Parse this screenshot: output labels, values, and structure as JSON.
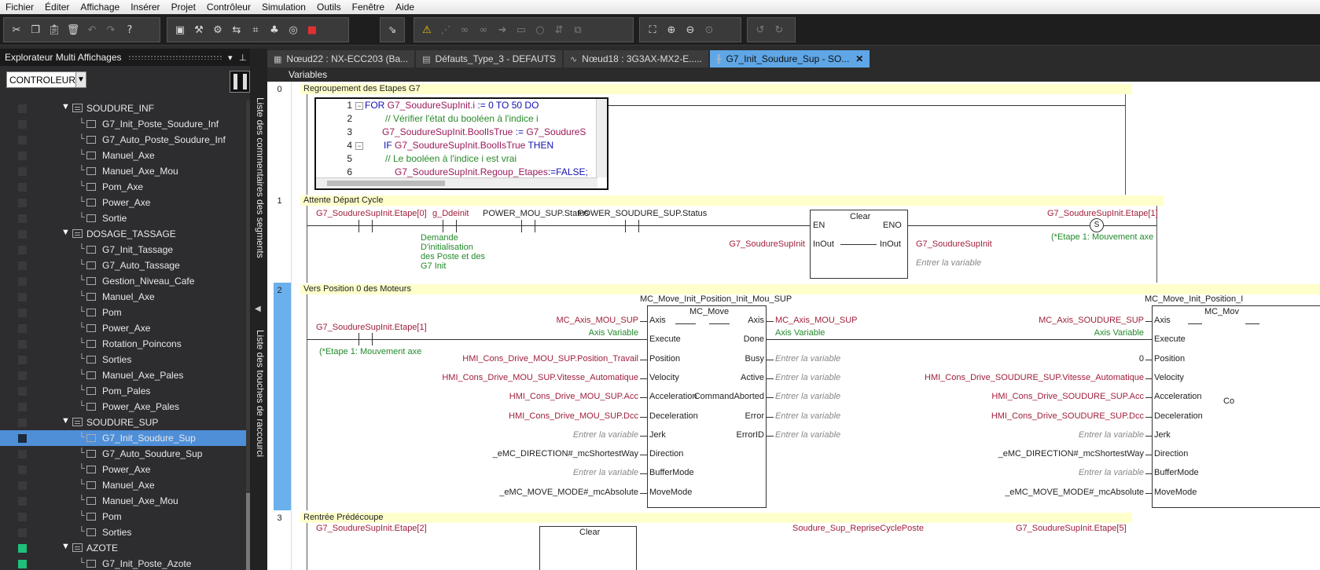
{
  "menu": [
    "Fichier",
    "Éditer",
    "Affichage",
    "Insérer",
    "Projet",
    "Contrôleur",
    "Simulation",
    "Outils",
    "Fenêtre",
    "Aide"
  ],
  "toolbar": {
    "group1": [
      "cut-icon",
      "copy-icon",
      "paste-icon",
      "delete-icon",
      "undo-icon",
      "redo-icon",
      "help-icon"
    ],
    "group2": [
      "build-icon",
      "hammer-icon",
      "tools-icon",
      "compare-icon",
      "cross-reference-icon",
      "binoculars-icon",
      "stop-icon"
    ],
    "group3": [
      "transfer-icon"
    ],
    "group4": [
      "warning-icon",
      "monitor-icon",
      "online-icon",
      "offline-icon",
      "step-icon",
      "pause-icon",
      "reset-icon",
      "sync-icon",
      "link-icon"
    ],
    "group5": [
      "zoom-fit-icon",
      "zoom-in-icon",
      "zoom-out-icon",
      "zoom-custom-icon"
    ],
    "group6": [
      "back-icon",
      "forward-icon"
    ]
  },
  "explorer": {
    "title": "Explorateur Multi Affichages",
    "controller": "CONTROLEUR",
    "rows": [
      {
        "type": "group",
        "label": "SOUDURE_INF",
        "sq": "gray"
      },
      {
        "type": "item",
        "label": "G7_Init_Poste_Soudure_Inf",
        "sq": "gray"
      },
      {
        "type": "item",
        "label": "G7_Auto_Poste_Soudure_Inf",
        "sq": "gray"
      },
      {
        "type": "item",
        "label": "Manuel_Axe",
        "sq": "gray"
      },
      {
        "type": "item",
        "label": "Manuel_Axe_Mou",
        "sq": "gray"
      },
      {
        "type": "item",
        "label": "Pom_Axe",
        "sq": "gray"
      },
      {
        "type": "item",
        "label": "Power_Axe",
        "sq": "gray"
      },
      {
        "type": "item",
        "label": "Sortie",
        "sq": "gray"
      },
      {
        "type": "group",
        "label": "DOSAGE_TASSAGE",
        "sq": "gray"
      },
      {
        "type": "item",
        "label": "G7_Init_Tassage",
        "sq": "gray"
      },
      {
        "type": "item",
        "label": "G7_Auto_Tassage",
        "sq": "gray"
      },
      {
        "type": "item",
        "label": "Gestion_Niveau_Cafe",
        "sq": "gray"
      },
      {
        "type": "item",
        "label": "Manuel_Axe",
        "sq": "gray"
      },
      {
        "type": "item",
        "label": "Pom",
        "sq": "gray"
      },
      {
        "type": "item",
        "label": "Power_Axe",
        "sq": "gray"
      },
      {
        "type": "item",
        "label": "Rotation_Poincons",
        "sq": "gray"
      },
      {
        "type": "item",
        "label": "Sorties",
        "sq": "gray"
      },
      {
        "type": "item",
        "label": "Manuel_Axe_Pales",
        "sq": "gray"
      },
      {
        "type": "item",
        "label": "Pom_Pales",
        "sq": "gray"
      },
      {
        "type": "item",
        "label": "Power_Axe_Pales",
        "sq": "gray"
      },
      {
        "type": "group",
        "label": "SOUDURE_SUP",
        "sq": "gray"
      },
      {
        "type": "item",
        "label": "G7_Init_Soudure_Sup",
        "sq": "dark",
        "selected": true
      },
      {
        "type": "item",
        "label": "G7_Auto_Soudure_Sup",
        "sq": "gray"
      },
      {
        "type": "item",
        "label": "Power_Axe",
        "sq": "gray"
      },
      {
        "type": "item",
        "label": "Manuel_Axe",
        "sq": "gray"
      },
      {
        "type": "item",
        "label": "Manuel_Axe_Mou",
        "sq": "gray"
      },
      {
        "type": "item",
        "label": "Pom",
        "sq": "gray"
      },
      {
        "type": "item",
        "label": "Sorties",
        "sq": "gray"
      },
      {
        "type": "group",
        "label": "AZOTE",
        "sq": "green"
      },
      {
        "type": "item",
        "label": "G7_Init_Poste_Azote",
        "sq": "green"
      }
    ]
  },
  "side_tabs": {
    "comments": "Liste des commentaires des segments",
    "shortcuts": "Liste des touches de raccourci"
  },
  "tabs": [
    {
      "label": "Nœud22 : NX-ECC203 (Ba...",
      "icon": "network-icon"
    },
    {
      "label": "Défauts_Type_3 - DEFAUTS",
      "icon": "table-icon"
    },
    {
      "label": "Nœud18 : 3G3AX-MX2-E.....",
      "icon": "drive-icon"
    },
    {
      "label": "G7_Init_Soudure_Sup - SO...",
      "icon": "ladder-icon",
      "active": true
    }
  ],
  "variables_label": "Variables",
  "rungs": {
    "r0": {
      "number": "0",
      "title": "Regroupement des Etapes G7",
      "st_line_numbers": [
        "1",
        "2",
        "3",
        "4",
        "5",
        "6"
      ],
      "st": {
        "l1a": "FOR ",
        "l1b": "G7_SoudureSupInit.i",
        "l1c": " := ",
        "l1d": "0",
        "l1e": " TO ",
        "l1f": "50",
        "l1g": " DO",
        "l2": "// Vérifier l'état du booléen à l'indice i",
        "l3a": "G7_SoudureSupInit.BoolIsTrue",
        "l3b": " := ",
        "l3c": "G7_SoudureS",
        "l4a": "IF ",
        "l4b": "G7_SoudureSupInit.BoolIsTrue",
        "l4c": " THEN",
        "l5": "// Le booléen à l'indice i est vrai",
        "l6a": "G7_SoudureSupInit.Regoup_Etapes",
        "l6b": ":=",
        "l6c": "FALSE;"
      }
    },
    "r1": {
      "number": "1",
      "title": "Attente Départ Cycle",
      "c1": "G7_SoudureSupInit.Etape[0]",
      "c2": "g_Ddeinit",
      "c2_comment": [
        "Demande",
        "D'initialisation",
        "des Poste et des",
        "G7 Init"
      ],
      "c3": "POWER_MOU_SUP.Status",
      "c4": "POWER_SOUDURE_SUP.Status",
      "fb_name": "Clear",
      "en": "EN",
      "eno": "ENO",
      "inout": "InOut",
      "in_var": "G7_SoudureSupInit",
      "out_var": "G7_SoudureSupInit",
      "out_placeholder": "Entrer la variable",
      "coil_var": "G7_SoudureSupInit.Etape[1]",
      "coil_type": "S",
      "coil_comment": "(*Etape 1: Mouvement axe"
    },
    "r2": {
      "number": "2",
      "title": "Vers Position 0 des Moteurs",
      "contact": "G7_SoudureSupInit.Etape[1]",
      "contact_comment": "(*Etape 1: Mouvement axe",
      "fb1_instance": "MC_Move_Init_Position_Init_Mou_SUP",
      "fb1_type": "MC_Move",
      "fb2_instance": "MC_Move_Init_Position_I",
      "fb2_type": "MC_Mov",
      "inputs": [
        "Axis",
        "Execute",
        "Position",
        "Velocity",
        "Acceleration",
        "Deceleration",
        "Jerk",
        "Direction",
        "BufferMode",
        "MoveMode"
      ],
      "outputs": [
        "Axis",
        "Done",
        "Busy",
        "Active",
        "CommandAborted",
        "Error",
        "ErrorID"
      ],
      "fb1_in_vars": [
        "MC_Axis_MOU_SUP",
        "",
        "HMI_Cons_Drive_MOU_SUP.Position_Travail",
        "HMI_Cons_Drive_MOU_SUP.Vitesse_Automatique",
        "HMI_Cons_Drive_MOU_SUP.Acc",
        "HMI_Cons_Drive_MOU_SUP.Dcc",
        "Entrer la variable",
        "_eMC_DIRECTION#_mcShortestWay",
        "Entrer la variable",
        "_eMC_MOVE_MODE#_mcAbsolute"
      ],
      "fb1_out_vars": [
        "MC_Axis_MOU_SUP",
        "",
        "Entrer la variable",
        "Entrer la variable",
        "Entrer la variable",
        "Entrer la variable",
        "Entrer la variable"
      ],
      "fb2_in_vars": [
        "MC_Axis_SOUDURE_SUP",
        "",
        "0",
        "HMI_Cons_Drive_SOUDURE_SUP.Vitesse_Automatique",
        "HMI_Cons_Drive_SOUDURE_SUP.Acc",
        "HMI_Cons_Drive_SOUDURE_SUP.Dcc",
        "Entrer la variable",
        "_eMC_DIRECTION#_mcShortestWay",
        "Entrer la variable",
        "_eMC_MOVE_MODE#_mcAbsolute"
      ],
      "axis_type": "Axis Variable",
      "fb2_cut_label": "Co"
    },
    "r3": {
      "number": "3",
      "title": "Rentrée Prédécoupe",
      "c1": "G7_SoudureSupInit.Etape[2]",
      "fb_name": "Clear",
      "var_mid": "Soudure_Sup_RepriseCyclePoste",
      "coil_var": "G7_SoudureSupInit.Etape[5]"
    }
  }
}
